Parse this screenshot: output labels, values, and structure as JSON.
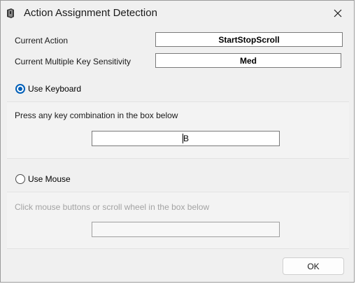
{
  "window": {
    "title": "Action Assignment Detection",
    "icon": "app-icon",
    "close_icon": "close-icon"
  },
  "current_action": {
    "label": "Current Action",
    "value": "StartStopScroll"
  },
  "sensitivity": {
    "label": "Current Multiple Key Sensitivity",
    "value": "Med"
  },
  "keyboard": {
    "radio_label": "Use Keyboard",
    "selected": true,
    "instruction": "Press any key combination in the box below",
    "input_value": "B"
  },
  "mouse": {
    "radio_label": "Use Mouse",
    "selected": false,
    "instruction": "Click mouse buttons or scroll wheel in the box below",
    "input_value": ""
  },
  "footer": {
    "ok_label": "OK"
  },
  "colors": {
    "accent": "#005fb8",
    "window_bg": "#f0f0f0",
    "disabled_text": "#a3a3a3"
  }
}
